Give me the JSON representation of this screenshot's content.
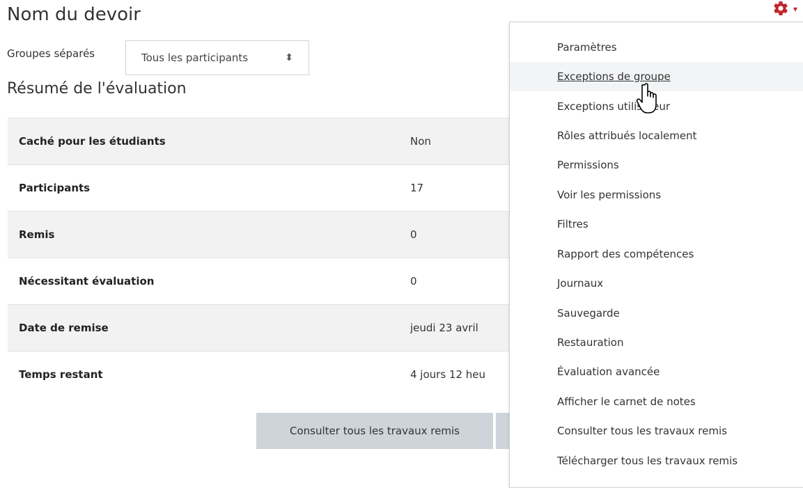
{
  "page": {
    "title": "Nom du devoir",
    "section_title": "Résumé de l'évaluation"
  },
  "groups": {
    "label": "Groupes séparés",
    "selected": "Tous les participants"
  },
  "summary": {
    "rows": [
      {
        "label": "Caché pour les étudiants",
        "value": "Non"
      },
      {
        "label": "Participants",
        "value": "17"
      },
      {
        "label": "Remis",
        "value": "0"
      },
      {
        "label": "Nécessitant évaluation",
        "value": "0"
      },
      {
        "label": "Date de remise",
        "value": "jeudi 23 avril"
      },
      {
        "label": "Temps restant",
        "value": "4 jours 12 heu"
      }
    ]
  },
  "buttons": {
    "view_all": "Consulter tous les travaux remis"
  },
  "menu": {
    "items": [
      "Paramètres",
      "Exceptions de groupe",
      "Exceptions utilisateur",
      "Rôles attribués localement",
      "Permissions",
      "Voir les permissions",
      "Filtres",
      "Rapport des compétences",
      "Journaux",
      "Sauvegarde",
      "Restauration",
      "Évaluation avancée",
      "Afficher le carnet de notes",
      "Consulter tous les travaux remis",
      "Télécharger tous les travaux remis"
    ],
    "hovered": "Exceptions de groupe"
  },
  "icons": {
    "settings": "gear-icon",
    "cursor": "hand-pointer-icon",
    "select_arrow": "sort-arrows-icon"
  },
  "colors": {
    "accent": "#c0272d",
    "table_stripe": "#f2f2f2",
    "button_bg": "#ced4da",
    "menu_hover": "#f2f4f6"
  }
}
